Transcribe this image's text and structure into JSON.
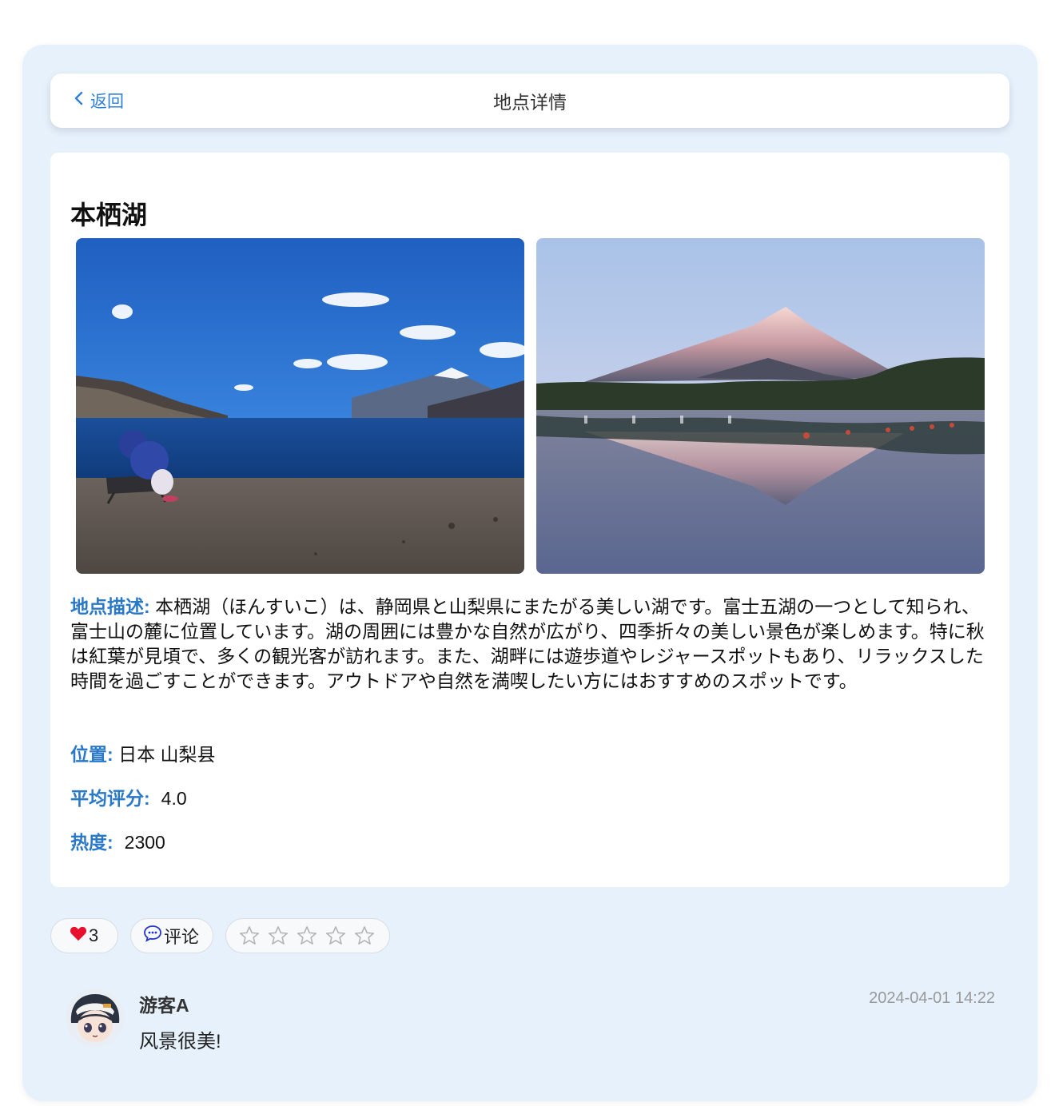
{
  "nav": {
    "back_label": "返回",
    "title": "地点详情"
  },
  "place": {
    "name": "本栖湖",
    "desc_label": "地点描述:",
    "description": "本栖湖（ほんすいこ）は、静岡県と山梨県にまたがる美しい湖です。富士五湖の一つとして知られ、富士山の麓に位置しています。湖の周囲には豊かな自然が広がり、四季折々の美しい景色が楽しめます。特に秋は紅葉が見頃で、多くの観光客が訪れます。また、湖畔には遊歩道やレジャースポットもあり、リラックスした時間を過ごすことができます。アウトドアや自然を満喫したい方にはおすすめのスポットです。",
    "location_label": "位置:",
    "location": "日本 山梨县",
    "rating_label": "平均评分:",
    "rating": "4.0",
    "heat_label": "热度:",
    "heat": "2300"
  },
  "photos": [
    {
      "icon": "lake-motosu-beach-photo"
    },
    {
      "icon": "mount-fuji-reflection-photo"
    }
  ],
  "actions": {
    "like_count": "3",
    "like_icon": "heart-icon",
    "like_color": "#e8112d",
    "comment_label": "评论",
    "comment_icon": "chat-bubble-icon",
    "star_rating": 0,
    "star_max": 5
  },
  "comments": [
    {
      "user": "游客A",
      "time": "2024-04-01 14:22",
      "text": "风景很美!"
    }
  ],
  "colors": {
    "accent": "#2a78c8",
    "panel_bg": "#e6f1fc"
  }
}
